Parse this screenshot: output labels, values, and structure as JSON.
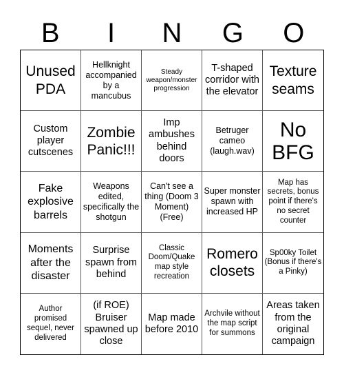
{
  "header": {
    "letters": [
      "B",
      "I",
      "N",
      "G",
      "O"
    ]
  },
  "cells": [
    {
      "text": "Unused PDA",
      "size": "s-l"
    },
    {
      "text": "Hellknight accompanied by a mancubus",
      "size": "s-s"
    },
    {
      "text": "Steady weapon/monster progression",
      "size": "s-xxs"
    },
    {
      "text": "T-shaped corridor with the elevator",
      "size": "s-m"
    },
    {
      "text": "Texture seams",
      "size": "s-l"
    },
    {
      "text": "Custom player cutscenes",
      "size": "s-m"
    },
    {
      "text": "Zombie Panic!!!",
      "size": "s-l"
    },
    {
      "text": "Imp ambushes behind doors",
      "size": "s-m"
    },
    {
      "text": "Betruger cameo (laugh.wav)",
      "size": "s-s"
    },
    {
      "text": "No BFG",
      "size": "s-xl"
    },
    {
      "text": "Fake explosive barrels",
      "size": "s-ml"
    },
    {
      "text": "Weapons edited, specifically the shotgun",
      "size": "s-s"
    },
    {
      "text": "Can't see a thing (Doom 3 Moment) (Free)",
      "size": "s-s"
    },
    {
      "text": "Super monster spawn with increased HP",
      "size": "s-s"
    },
    {
      "text": "Map has secrets, bonus point if there's no secret counter",
      "size": "s-xs"
    },
    {
      "text": "Moments after the disaster",
      "size": "s-ml"
    },
    {
      "text": "Surprise spawn from behind",
      "size": "s-m"
    },
    {
      "text": "Classic Doom/Quake map style recreation",
      "size": "s-xs"
    },
    {
      "text": "Romero closets",
      "size": "s-l"
    },
    {
      "text": "Sp00ky Toilet (Bonus if there's a Pinky)",
      "size": "s-xs"
    },
    {
      "text": "Author promised sequel, never delivered",
      "size": "s-xs"
    },
    {
      "text": "(if ROE) Bruiser spawned up close",
      "size": "s-m"
    },
    {
      "text": "Map made before 2010",
      "size": "s-m"
    },
    {
      "text": "Archvile without the map script for summons",
      "size": "s-xs"
    },
    {
      "text": "Areas taken from the original campaign",
      "size": "s-m"
    }
  ]
}
